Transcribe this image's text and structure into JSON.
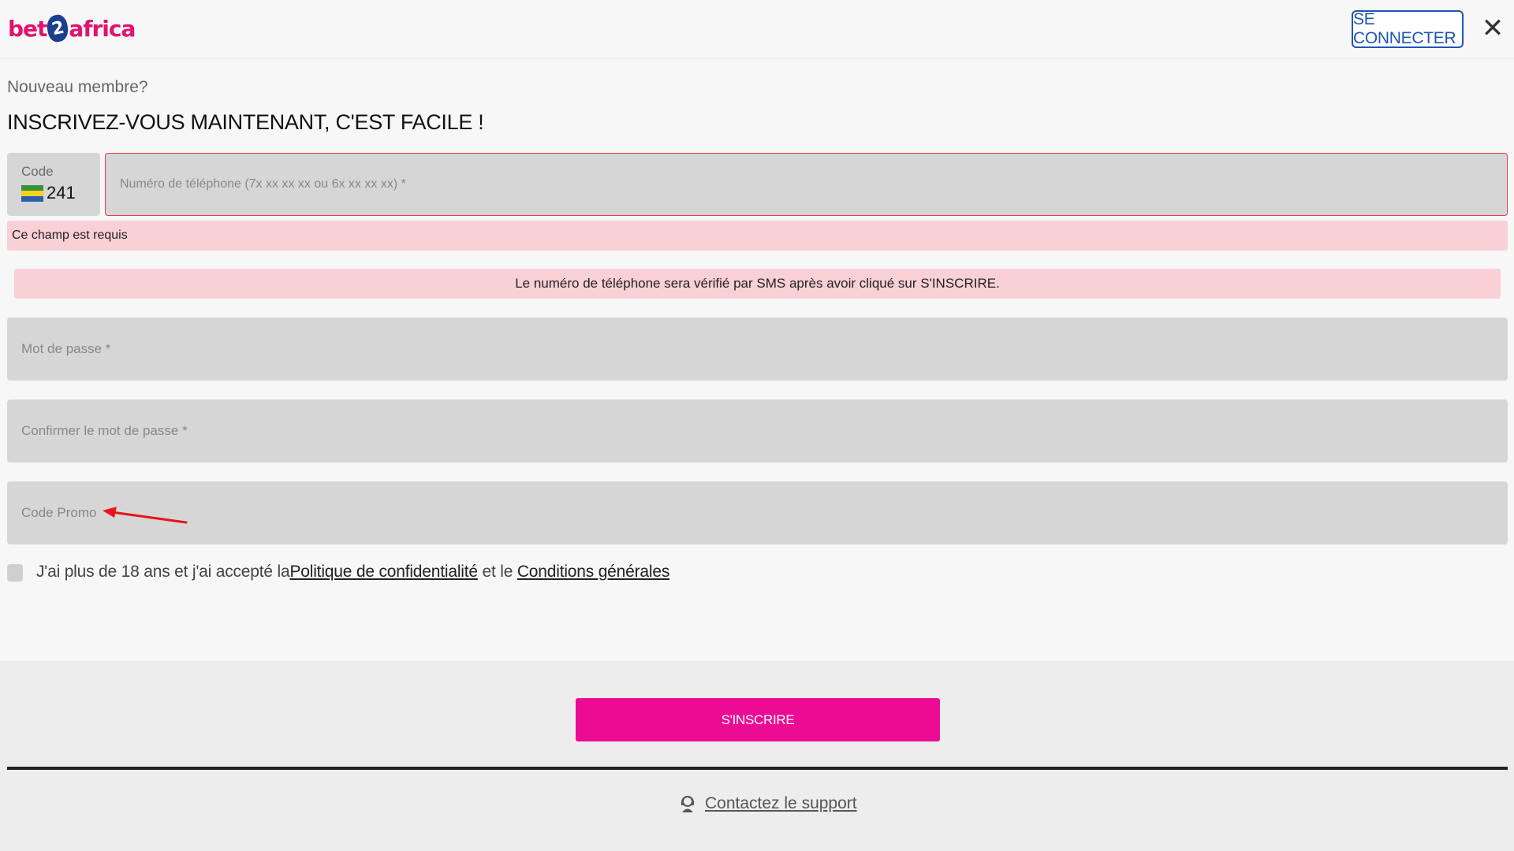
{
  "header": {
    "logo": {
      "part1": "bet",
      "part2": "2",
      "part3": "africa"
    },
    "login_label": "SE CONNECTER",
    "close_glyph": "✕",
    "icons": {
      "close": "close-icon"
    }
  },
  "intro": {
    "subtitle": "Nouveau membre?",
    "title": "INSCRIVEZ-VOUS MAINTENANT, C'EST FACILE !"
  },
  "form": {
    "code": {
      "label": "Code",
      "value": "241",
      "flag": "gabon-flag-icon",
      "flag_colors": [
        "#3a8f3a",
        "#f5d31a",
        "#2a5fb0"
      ]
    },
    "phone": {
      "placeholder": "Numéro de téléphone (7x xx xx xx ou 6x xx xx xx) *",
      "error": "Ce champ est requis"
    },
    "sms_info": "Le numéro de téléphone sera vérifié par SMS après avoir cliqué sur S'INSCRIRE.",
    "password": {
      "placeholder": "Mot de passe *"
    },
    "confirm_password": {
      "placeholder": "Confirmer le mot de passe *"
    },
    "promo": {
      "placeholder": "Code Promo"
    },
    "terms": {
      "prefix": "J'ai plus de 18 ans et j'ai accepté la",
      "privacy_link": "Politique de confidentialité",
      "middle": " et le ",
      "conditions_link": "Conditions générales"
    }
  },
  "footer": {
    "signup_label": "S'INSCRIRE",
    "support_label": "Contactez le support",
    "support_icon": "support-agent-icon"
  },
  "colors": {
    "brand_pink": "#ec0c94",
    "login_blue": "#1e55b3",
    "error_bg": "#f8d0d5",
    "error_border": "#e23b4b",
    "annotation_red": "#e8141c"
  }
}
